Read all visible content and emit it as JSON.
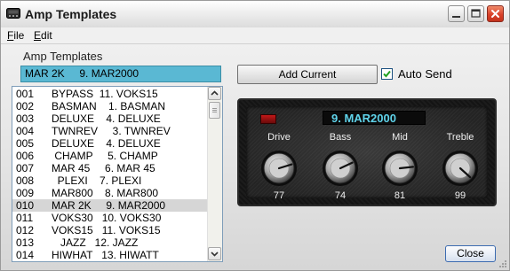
{
  "window": {
    "title": "Amp Templates",
    "controls": {
      "minimize": "minimize",
      "maximize": "maximize",
      "close": "close"
    }
  },
  "menu": {
    "file": {
      "mnemonic": "F",
      "rest": "ile"
    },
    "edit": {
      "mnemonic": "E",
      "rest": "dit"
    }
  },
  "section_label": "Amp Templates",
  "current_preset": "MAR 2K     9. MAR2000",
  "presets": [
    {
      "num": "001",
      "name": "BYPASS  11. VOKS15"
    },
    {
      "num": "002",
      "name": "BASMAN    1. BASMAN"
    },
    {
      "num": "003",
      "name": "DELUXE    4. DELUXE"
    },
    {
      "num": "004",
      "name": "TWNREV     3. TWNREV"
    },
    {
      "num": "005",
      "name": "DELUXE    4. DELUXE"
    },
    {
      "num": "006",
      "name": " CHAMP     5. CHAMP"
    },
    {
      "num": "007",
      "name": "MAR 45     6. MAR 45"
    },
    {
      "num": "008",
      "name": "  PLEXI    7. PLEXI"
    },
    {
      "num": "009",
      "name": "MAR800    8. MAR800"
    },
    {
      "num": "010",
      "name": "MAR 2K     9. MAR2000"
    },
    {
      "num": "011",
      "name": "VOKS30   10. VOKS30"
    },
    {
      "num": "012",
      "name": "VOKS15   11. VOKS15"
    },
    {
      "num": "013",
      "name": "   JAZZ   12. JAZZ"
    },
    {
      "num": "014",
      "name": "HIWHAT   13. HIWATT"
    }
  ],
  "selected_preset_index": 9,
  "add_current_label": "Add Current",
  "auto_send": {
    "label": "Auto Send",
    "checked": true
  },
  "amp": {
    "display": "9. MAR2000",
    "knobs": [
      {
        "label": "Drive",
        "value": "77"
      },
      {
        "label": "Bass",
        "value": "74"
      },
      {
        "label": "Mid",
        "value": "81"
      },
      {
        "label": "Treble",
        "value": "99"
      }
    ]
  },
  "close_label": "Close",
  "icons": {
    "app": "amp-icon",
    "check": "check-icon",
    "scroll_up": "chevron-up-icon",
    "scroll_down": "chevron-down-icon"
  },
  "colors": {
    "selection": "#5ab8d3",
    "display_text": "#5fd3ea",
    "led": "#c21818",
    "close_button": "#d9412a"
  }
}
